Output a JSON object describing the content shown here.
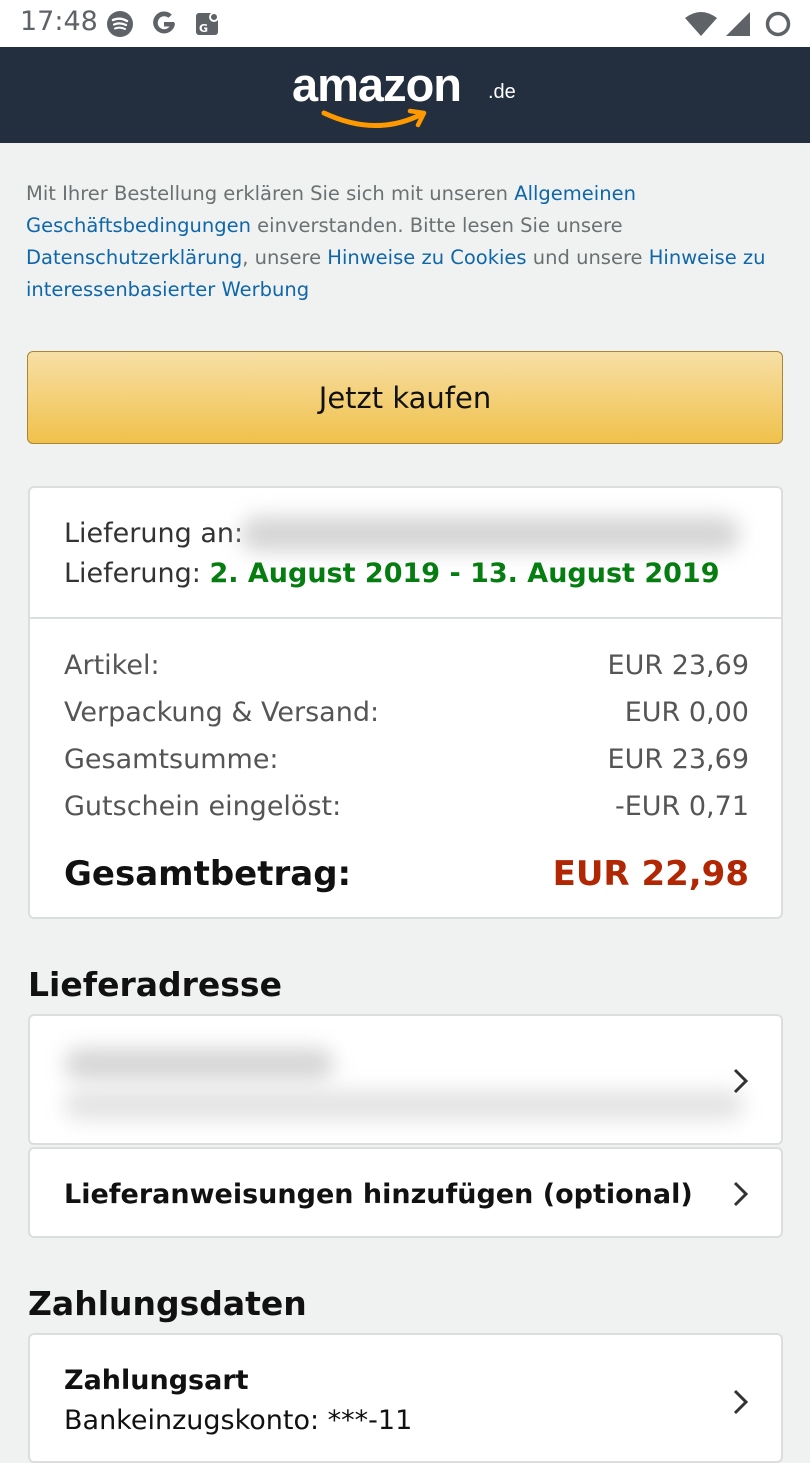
{
  "status_bar": {
    "time": "17:48",
    "left_icons": [
      "spotify-icon",
      "google-icon",
      "maps-icon"
    ],
    "right_icons": [
      "wifi-icon",
      "signal-icon",
      "battery-icon"
    ]
  },
  "header": {
    "logo_word": "amazon",
    "logo_tld": ".de",
    "background": "#232f3e"
  },
  "terms": {
    "t1": "Mit Ihrer Bestellung erklären Sie sich mit unseren ",
    "link_agb": "Allgemeinen Geschäftsbedingungen",
    "t2": " einverstanden. Bitte lesen Sie unsere ",
    "link_privacy": "Datenschutzerklärung",
    "t3": ", unsere ",
    "link_cookies": "Hinweise zu Cookies",
    "t4": " und unsere ",
    "link_ads": "Hinweise zu interessenbasierter Werbung"
  },
  "buy_button": {
    "label": "Jetzt kaufen"
  },
  "delivery": {
    "to_label": "Lieferung an:",
    "date_label": "Lieferung:",
    "date_value": "2. August 2019 - 13. August 2019"
  },
  "summary": {
    "rows": [
      {
        "label": "Artikel:",
        "value": "EUR 23,69"
      },
      {
        "label": "Verpackung & Versand:",
        "value": "EUR 0,00"
      },
      {
        "label": "Gesamtsumme:",
        "value": "EUR 23,69"
      },
      {
        "label": "Gutschein eingelöst:",
        "value": "-EUR 0,71"
      }
    ],
    "total_label": "Gesamtbetrag:",
    "total_value": "EUR 22,98"
  },
  "shipping": {
    "title": "Lieferadresse",
    "instructions_label": "Lieferanweisungen hinzufügen (optional)"
  },
  "payment": {
    "title": "Zahlungsdaten",
    "method_label": "Zahlungsart",
    "account_label": "Bankeinzugskonto:",
    "account_value": "***-11"
  },
  "colors": {
    "link": "#0f66a8",
    "delivery_green": "#067d10",
    "total_red": "#b12704",
    "button_yellow": "#f0c14b"
  }
}
